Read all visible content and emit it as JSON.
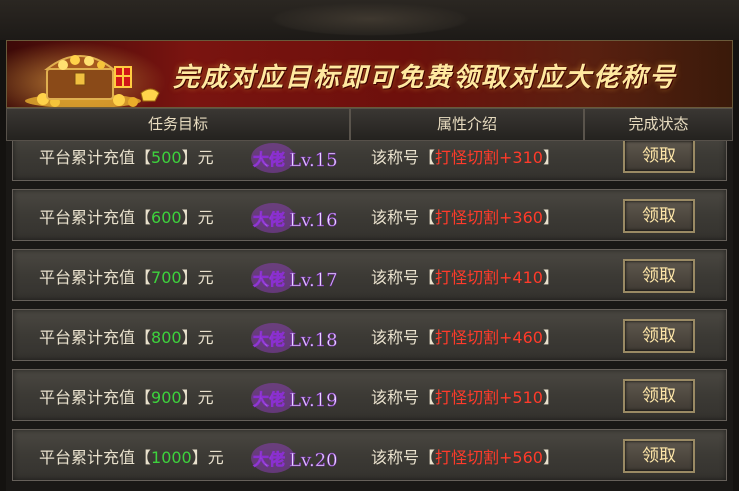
{
  "banner": {
    "title": "完成对应目标即可免费领取对应大佬称号"
  },
  "columns": {
    "task": "任务目标",
    "attribute": "属性介绍",
    "status": "完成状态"
  },
  "rows": [
    {
      "task_prefix": "平台累计充值【",
      "amount": "500",
      "task_suffix": "】元",
      "rank_prefix": "大佬",
      "rank_level": "Lv.15",
      "desc_prefix": "该称号【",
      "attr": "打怪切割+310",
      "desc_suffix": "】",
      "button": "领取"
    },
    {
      "task_prefix": "平台累计充值【",
      "amount": "600",
      "task_suffix": "】元",
      "rank_prefix": "大佬",
      "rank_level": "Lv.16",
      "desc_prefix": "该称号【",
      "attr": "打怪切割+360",
      "desc_suffix": "】",
      "button": "领取"
    },
    {
      "task_prefix": "平台累计充值【",
      "amount": "700",
      "task_suffix": "】元",
      "rank_prefix": "大佬",
      "rank_level": "Lv.17",
      "desc_prefix": "该称号【",
      "attr": "打怪切割+410",
      "desc_suffix": "】",
      "button": "领取"
    },
    {
      "task_prefix": "平台累计充值【",
      "amount": "800",
      "task_suffix": "】元",
      "rank_prefix": "大佬",
      "rank_level": "Lv.18",
      "desc_prefix": "该称号【",
      "attr": "打怪切割+460",
      "desc_suffix": "】",
      "button": "领取"
    },
    {
      "task_prefix": "平台累计充值【",
      "amount": "900",
      "task_suffix": "】元",
      "rank_prefix": "大佬",
      "rank_level": "Lv.19",
      "desc_prefix": "该称号【",
      "attr": "打怪切割+510",
      "desc_suffix": "】",
      "button": "领取"
    },
    {
      "task_prefix": "平台累计充值【",
      "amount": "1000",
      "task_suffix": "】元",
      "rank_prefix": "大佬",
      "rank_level": "Lv.20",
      "desc_prefix": "该称号【",
      "attr": "打怪切割+560",
      "desc_suffix": "】",
      "button": "领取"
    }
  ],
  "icons": {
    "chest": "treasure-chest-icon",
    "rank_effect": "purple-flame-title-effect"
  },
  "colors": {
    "amount": "#3dd23d",
    "attribute": "#ff3a2a",
    "rank_glow": "#b04ae0",
    "banner_text": "#ffe9a0"
  }
}
